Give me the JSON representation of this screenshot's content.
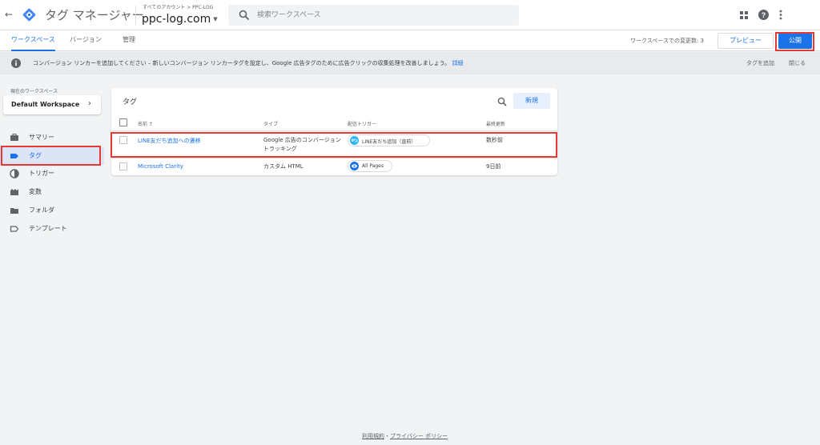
{
  "colors": {
    "accent": "#1a73e8",
    "highlight": "#e53935",
    "publish": "#1a73e8"
  },
  "header": {
    "product_name": "タグ マネージャー",
    "account_path": "すべてのアカウント > PPC-LOG",
    "container_name": "ppc-log.com",
    "search_placeholder": "検索ワークスペース"
  },
  "tabs": [
    {
      "label": "ワークスペース"
    },
    {
      "label": "バージョン"
    },
    {
      "label": "管理"
    }
  ],
  "toolbar": {
    "changes_label": "ワークスペースでの変更数: 3",
    "preview_label": "プレビュー",
    "publish_label": "公開"
  },
  "notice": {
    "text": "コンバージョン リンカーを追加してください – 新しいコンバージョン リンカータグを設定し、Google 広告タグのために広告クリックの収集処理を改善しましょう。",
    "link": "詳細",
    "add_tag": "タグを追加",
    "close": "閉じる"
  },
  "sidebar": {
    "workspace_label": "現在のワークスペース",
    "workspace_name": "Default Workspace",
    "items": [
      {
        "label": "サマリー",
        "icon": "briefcase-icon"
      },
      {
        "label": "タグ",
        "icon": "tag-icon"
      },
      {
        "label": "トリガー",
        "icon": "trigger-icon"
      },
      {
        "label": "変数",
        "icon": "variable-icon"
      },
      {
        "label": "フォルダ",
        "icon": "folder-icon"
      },
      {
        "label": "テンプレート",
        "icon": "template-icon"
      }
    ]
  },
  "tags_card": {
    "title": "タグ",
    "new_label": "新規",
    "columns": {
      "name": "名前 ↑",
      "type": "タイプ",
      "trigger": "配信トリガー",
      "updated": "最終更新"
    },
    "rows": [
      {
        "name": "LINE友だち追加への遷移",
        "type_line1": "Google 広告のコンバージョン",
        "type_line2": "トラッキング",
        "trigger": "LINE友だち追加（直前）",
        "updated": "数秒前"
      },
      {
        "name": "Microsoft Clarity",
        "type_line1": "カスタム HTML",
        "type_line2": "",
        "trigger": "All Pages",
        "updated": "9日前"
      }
    ]
  },
  "footer": {
    "terms": "利用規約",
    "separator": "・",
    "privacy": "プライバシー ポリシー"
  }
}
